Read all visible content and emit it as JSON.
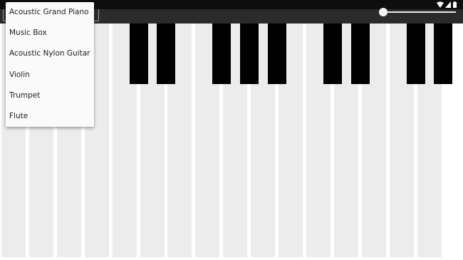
{
  "instrument_menu": {
    "items": [
      {
        "label": "Acoustic Grand Piano"
      },
      {
        "label": "Music Box"
      },
      {
        "label": "Acoustic Nylon Guitar"
      },
      {
        "label": "Violin"
      },
      {
        "label": "Trumpet"
      },
      {
        "label": "Flute"
      }
    ]
  },
  "status_bar": {
    "icons": [
      "wifi-icon",
      "cellular-signal-icon",
      "battery-icon"
    ]
  },
  "volume_slider": {
    "value_fraction": 0.0
  },
  "keyboard": {
    "white_key_count": 16,
    "black_key_count": 10
  },
  "colors": {
    "status_bar": "#0e0e0e",
    "toolbar": "#2b2b2b",
    "white_key": "#ececec",
    "black_key": "#000000",
    "menu_background": "#fafafa"
  }
}
